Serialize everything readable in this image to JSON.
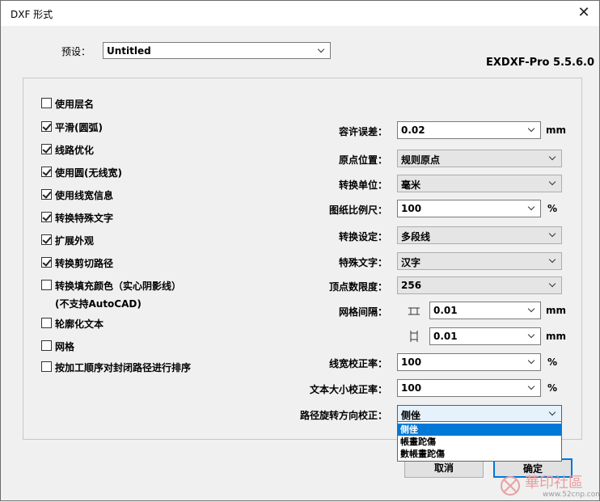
{
  "window": {
    "title": "DXF 形式"
  },
  "preset": {
    "label": "预设：",
    "value": "Untitled"
  },
  "version": "EXDXF-Pro 5.5.6.0",
  "checkboxes": [
    {
      "label": "使用层名",
      "checked": false
    },
    {
      "label": "平滑(圆弧)",
      "checked": true
    },
    {
      "label": "线路优化",
      "checked": true
    },
    {
      "label": "使用圆(无线宽)",
      "checked": true
    },
    {
      "label": "使用线宽信息",
      "checked": true
    },
    {
      "label": "转换特殊文字",
      "checked": true
    },
    {
      "label": "扩展外观",
      "checked": true
    },
    {
      "label": "转换剪切路径",
      "checked": true
    },
    {
      "label": "转换填充颜色（实心阴影线）",
      "checked": false
    },
    {
      "label": "轮廓化文本",
      "checked": false
    },
    {
      "label": "网格",
      "checked": false
    },
    {
      "label": "按加工顺序对封闭路径进行排序",
      "checked": false
    }
  ],
  "checkbox_note": "(不支持AutoCAD)",
  "fields": {
    "tolerance": {
      "label": "容许误差：",
      "value": "0.02",
      "unit": "mm"
    },
    "origin": {
      "label": "原点位置：",
      "value": "规则原点"
    },
    "unit_convert": {
      "label": "转换单位：",
      "value": "毫米"
    },
    "scale": {
      "label": "图纸比例尺：",
      "value": "100",
      "unit": "%"
    },
    "convert_setting": {
      "label": "转换设定：",
      "value": "多段线"
    },
    "special_text": {
      "label": "特殊文字：",
      "value": "汉字"
    },
    "vertex_limit": {
      "label": "顶点数限度：",
      "value": "256"
    },
    "grid_spacing": {
      "label": "网格间隔：",
      "x_value": "0.01",
      "y_value": "0.01",
      "unit": "mm"
    },
    "line_width_corr": {
      "label": "线宽校正率：",
      "value": "100",
      "unit": "%"
    },
    "text_size_corr": {
      "label": "文本大小校正率：",
      "value": "100",
      "unit": "%"
    },
    "path_rotation": {
      "label": "路径旋转方向校正：",
      "value": "侧侳"
    }
  },
  "dropdown_options": [
    "侧侳",
    "帳畫跎傷",
    "數帳畫跎傷"
  ],
  "buttons": {
    "cancel": "取消",
    "ok": "确定"
  },
  "watermark": {
    "text": "華印社區",
    "url": "www.52cnp.com"
  }
}
